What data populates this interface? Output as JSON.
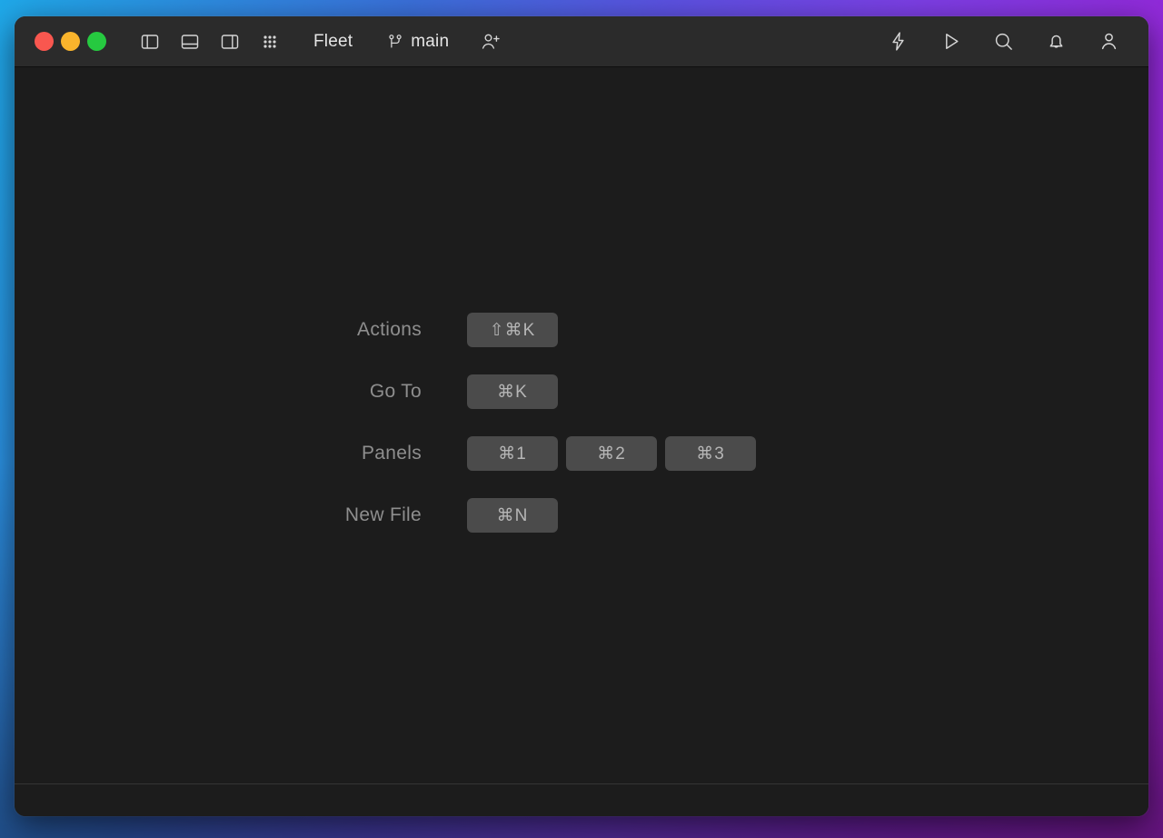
{
  "window": {
    "app_title": "Fleet",
    "branch": "main"
  },
  "titlebar": {
    "traffic_lights": [
      {
        "name": "close",
        "color": "#f9574f"
      },
      {
        "name": "minimize",
        "color": "#f9b42c"
      },
      {
        "name": "maximize",
        "color": "#26c940"
      }
    ],
    "left_icons": [
      {
        "name": "left-panel-icon",
        "label": "Left Panel"
      },
      {
        "name": "bottom-panel-icon",
        "label": "Bottom Panel"
      },
      {
        "name": "right-panel-icon",
        "label": "Right Panel"
      },
      {
        "name": "grid-dots-icon",
        "label": "All Panels"
      }
    ],
    "branch_icon": "git-branch-icon",
    "add_user_icon": "add-user-icon",
    "right_icons": [
      {
        "name": "lightning-icon",
        "label": "Smart Mode"
      },
      {
        "name": "play-icon",
        "label": "Run"
      },
      {
        "name": "search-icon",
        "label": "Search"
      },
      {
        "name": "notifications-icon",
        "label": "Notifications"
      },
      {
        "name": "account-icon",
        "label": "Account"
      }
    ]
  },
  "main": {
    "shortcuts": [
      {
        "label": "Actions",
        "keys": [
          "⇧⌘K"
        ]
      },
      {
        "label": "Go To",
        "keys": [
          "⌘K"
        ]
      },
      {
        "label": "Panels",
        "keys": [
          "⌘1",
          "⌘2",
          "⌘3"
        ]
      },
      {
        "label": "New File",
        "keys": [
          "⌘N"
        ]
      }
    ]
  },
  "colors": {
    "window_background": "#1c1c1c",
    "titlebar_background": "#2b2b2b",
    "key_pill_background": "#4b4b4b",
    "label_text": "#8e8e8e",
    "key_text": "#b6b6b6",
    "icon_stroke": "#d6d6d6",
    "desktop_gradient_start": "#1fa8e8",
    "desktop_gradient_end": "#a020c8"
  }
}
